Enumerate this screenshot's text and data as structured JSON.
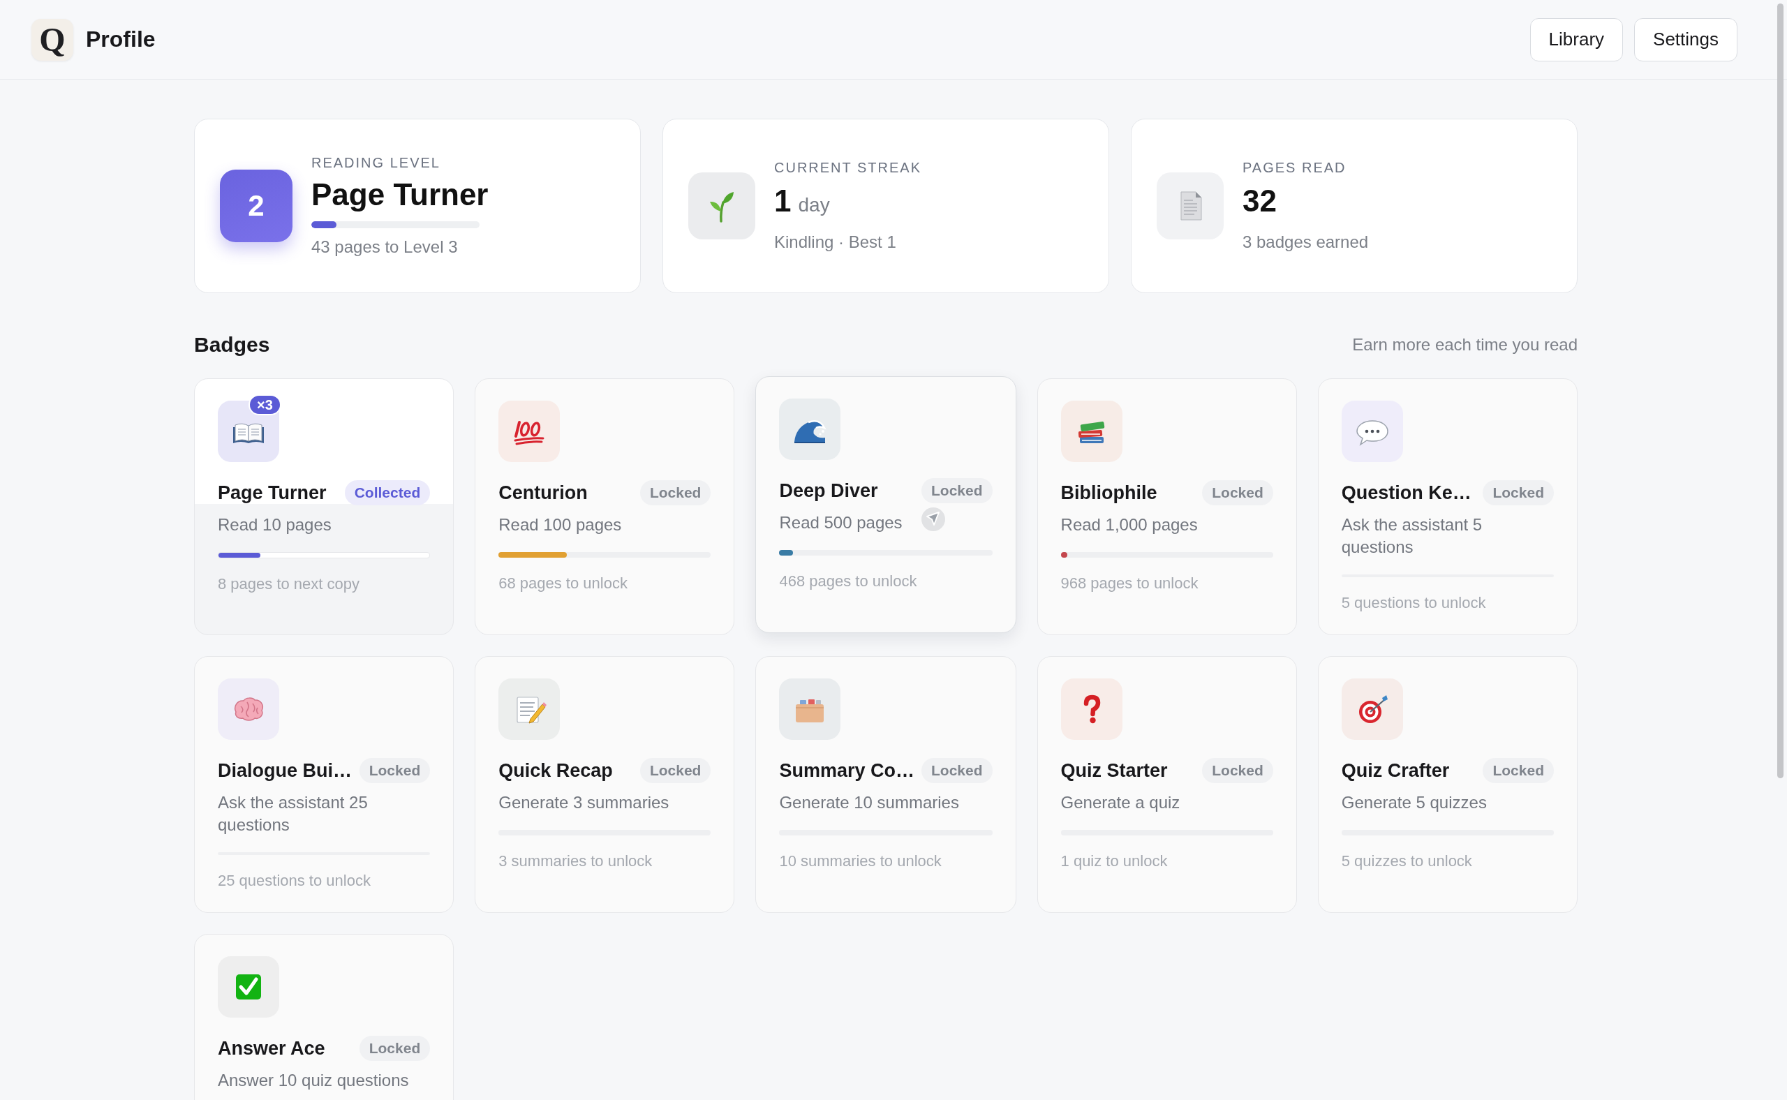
{
  "header": {
    "logo": "Q",
    "title": "Profile",
    "buttons": [
      "Library",
      "Settings"
    ]
  },
  "stats": [
    {
      "kind": "level",
      "label": "READING LEVEL",
      "badge": "2",
      "value": "Page Turner",
      "level": 0.15,
      "caption": "43 pages to Level 3"
    },
    {
      "kind": "streak",
      "label": "CURRENT STREAK",
      "value": "1",
      "unit": "day",
      "caption": "Kindling · Best 1"
    },
    {
      "kind": "pages",
      "label": "PAGES READ",
      "value": "32",
      "caption": "3 badges earned"
    }
  ],
  "badges": {
    "title": "Badges",
    "hint": "Earn more each time you read",
    "items": [
      {
        "name": "Page Turner",
        "status": "Collected",
        "collected": true,
        "hovered": false,
        "copies": "×3",
        "description": "Read 10 pages",
        "level": 0.2,
        "color": "#5b5bd6",
        "footer": "8 pages to next copy"
      },
      {
        "name": "Centurion",
        "status": "Locked",
        "collected": false,
        "hovered": false,
        "description": "Read 100 pages",
        "level": 0.32,
        "color": "#e1a032",
        "footer": "68 pages to unlock"
      },
      {
        "name": "Deep Diver",
        "status": "Locked",
        "collected": false,
        "hovered": true,
        "description": "Read 500 pages",
        "level": 0.064,
        "color": "#3a7ca5",
        "footer": "468 pages to unlock"
      },
      {
        "name": "Bibliophile",
        "status": "Locked",
        "collected": false,
        "hovered": false,
        "description": "Read 1,000 pages",
        "level": 0.032,
        "color": "#c4474d",
        "footer": "968 pages to unlock"
      },
      {
        "name": "Question Ke…",
        "status": "Locked",
        "collected": false,
        "hovered": false,
        "description": "Ask the assistant 5 questions",
        "footer": "5 questions to unlock"
      },
      {
        "name": "Dialogue Bui…",
        "status": "Locked",
        "collected": false,
        "hovered": false,
        "description": "Ask the assistant 25 questions",
        "footer": "25 questions to unlock"
      },
      {
        "name": "Quick Recap",
        "status": "Locked",
        "collected": false,
        "hovered": false,
        "description": "Generate 3 summaries",
        "footer": "3 summaries to unlock"
      },
      {
        "name": "Summary Co…",
        "status": "Locked",
        "collected": false,
        "hovered": false,
        "description": "Generate 10 summaries",
        "footer": "10 summaries to unlock"
      },
      {
        "name": "Quiz Starter",
        "status": "Locked",
        "collected": false,
        "hovered": false,
        "description": "Generate a quiz",
        "footer": "1 quiz to unlock"
      },
      {
        "name": "Quiz Crafter",
        "status": "Locked",
        "collected": false,
        "hovered": false,
        "description": "Generate 5 quizzes",
        "footer": "5 quizzes to unlock"
      },
      {
        "name": "Answer Ace",
        "status": "Locked",
        "collected": false,
        "hovered": false,
        "description": "Answer 10 quiz questions"
      }
    ]
  }
}
